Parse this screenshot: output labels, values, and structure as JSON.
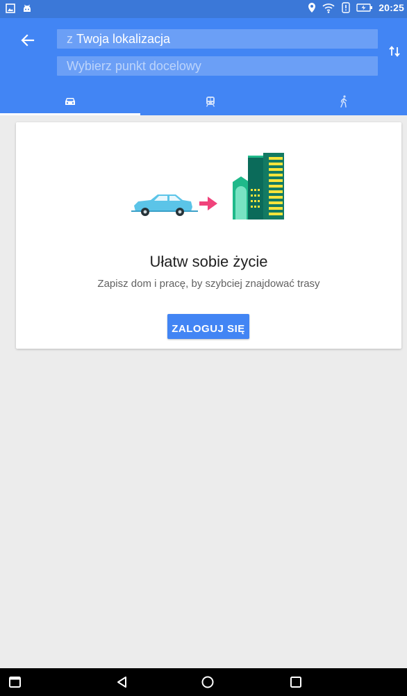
{
  "status_bar": {
    "time": "20:25",
    "left_icons": [
      "gallery-icon",
      "android-icon"
    ],
    "right_icons": [
      "location-icon",
      "wifi-icon",
      "notification-icon",
      "battery-charging-icon"
    ]
  },
  "directions": {
    "origin_prefix": "z",
    "origin": "Twoja lokalizacja",
    "destination_placeholder": "Wybierz punkt docelowy",
    "modes": [
      "car-icon",
      "transit-icon",
      "walk-icon"
    ],
    "selected_mode": "car"
  },
  "card": {
    "title": "Ułatw sobie życie",
    "subtitle": "Zapisz dom i pracę, by szybciej znajdować trasy",
    "button_label": "ZALOGUJ SIĘ"
  },
  "nav_bar": {
    "buttons": [
      "recents-square-icon",
      "back-triangle-icon",
      "home-circle-icon",
      "overview-square-icon"
    ]
  },
  "colors": {
    "header": "#4285f4",
    "status_bar": "#3b78d8",
    "background": "#ececec",
    "arrow_accent": "#f0437b",
    "car": "#5bc4e8",
    "building_green": "#1fb98a",
    "building_dark": "#0b6b5a",
    "building_yellow": "#f7e43b"
  }
}
